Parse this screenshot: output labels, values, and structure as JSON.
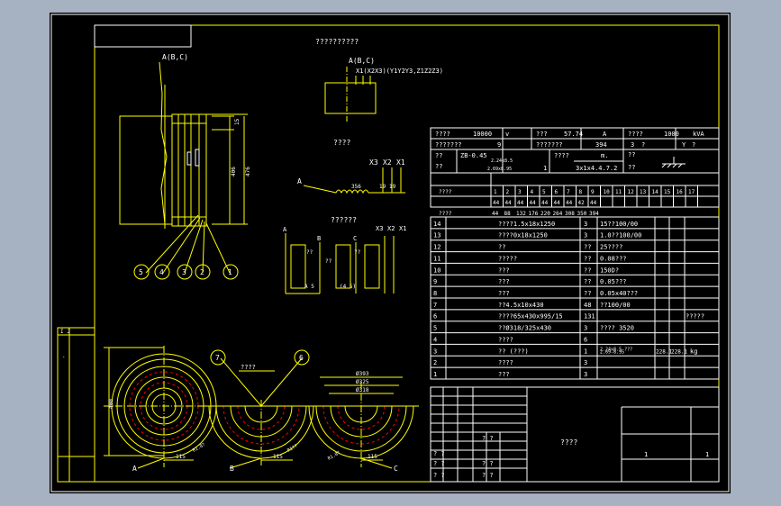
{
  "colors": {
    "background": "#a6b1c2",
    "sheet": "#000000",
    "frame": "#ffffff",
    "lines": "#ffff00",
    "text": "#ffffff",
    "red": "#ff0000"
  },
  "drawing": {
    "title_top": "??????????",
    "view_label_left": "A(B,C)",
    "view_label_right": "A(B,C)",
    "winding_terminals": "X1(X2X3)(Y1Y2Y3,Z1Z2Z3)",
    "tap_title": "????",
    "tap_terminals": [
      "X3",
      "X2",
      "X1"
    ],
    "tap_a": "A",
    "tap_numbers": [
      "356",
      "19",
      "19"
    ],
    "wiring_title": "??????",
    "wiring_terminals": [
      "X3",
      "X2",
      "X1"
    ],
    "wiring_phases": [
      "A",
      "B",
      "C"
    ],
    "wiring_marks": [
      "??",
      "??",
      "??"
    ],
    "wiring_bottom": [
      "A 5",
      "(4 5)"
    ],
    "dim_15": "15",
    "dim_406": "406",
    "dim_476": "476",
    "callouts": [
      "5",
      "4",
      "3",
      "2",
      "1",
      "7",
      "6"
    ],
    "plan_labels": [
      "A",
      "B",
      "C"
    ],
    "dim_400": "400",
    "dim_115": [
      "115",
      "115",
      "115"
    ],
    "plan_center_mark": "????",
    "dims_c": [
      "Ø393",
      "Ø325",
      "Ø318"
    ],
    "small_dims": [
      "R1.8?",
      "R1??",
      "R1.8?"
    ],
    "left_strip": [
      "I J",
      "."
    ]
  },
  "spec_table": {
    "rows": [
      [
        "????",
        "10000",
        "v",
        "???",
        "57.74",
        "A",
        "????",
        "1000",
        "kVA"
      ],
      [
        "???????",
        "9",
        "",
        "???????",
        "394",
        "",
        "3",
        "?",
        "Y",
        "?"
      ]
    ],
    "row3": {
      "label1": "??",
      "label2": "??",
      "code": "ZB-0.45",
      "wire1": "2.24x8.5",
      "wire2": "2.69x8.95",
      "mid_label": "????",
      "unit": "m.",
      "n1": "1",
      "n2": "3x1x4.4.7.2",
      "r_label": "??",
      "r2": "??"
    },
    "count_header": [
      "????",
      "1",
      "2",
      "3",
      "4",
      "5",
      "6",
      "7",
      "8",
      "9",
      "10",
      "11",
      "12",
      "13",
      "14",
      "15",
      "16",
      "17"
    ],
    "count_row1": [
      "44",
      "44",
      "44",
      "44",
      "44",
      "44",
      "44",
      "42",
      "44"
    ],
    "count_row2": [
      "????",
      "44",
      "88",
      "132",
      "176",
      "220",
      "264",
      "308",
      "350",
      "394"
    ]
  },
  "bom": [
    {
      "n": "14",
      "name": "????1.5x18x1250",
      "qty": "3",
      "spec": "15??100/00"
    },
    {
      "n": "13",
      "name": "????0x18x1250",
      "qty": "3",
      "spec": "1.0??100/00"
    },
    {
      "n": "12",
      "name": "??",
      "qty": "??",
      "spec": "25????"
    },
    {
      "n": "11",
      "name": "?????",
      "qty": "??",
      "spec": "0.08???"
    },
    {
      "n": "10",
      "name": "???",
      "qty": "??",
      "spec": "150D?"
    },
    {
      "n": "9",
      "name": "???",
      "qty": "??",
      "spec": "0.05???"
    },
    {
      "n": "8",
      "name": "???",
      "qty": "??",
      "spec": "0.05x40???"
    },
    {
      "n": "7",
      "name": "??4.5x10x430",
      "qty": "48",
      "spec": "??100/00"
    },
    {
      "n": "6",
      "name": "????65x430x995/15",
      "qty": "131",
      "spec": "",
      "extra": "?????"
    },
    {
      "n": "5",
      "name": "??Ø318/325x430",
      "qty": "3",
      "spec": "???? 3520"
    },
    {
      "n": "4",
      "name": "????",
      "qty": "6",
      "spec": ""
    },
    {
      "n": "3",
      "name": "?? (???)",
      "qty": "1",
      "spec": "2.24x8.5 ???",
      "spec2": "2.69-8.95",
      "w1": "228.1",
      "w2": "228.1",
      "u": "kg"
    },
    {
      "n": "2",
      "name": "????",
      "qty": "3",
      "spec": ""
    },
    {
      "n": "1",
      "name": "???",
      "qty": "3",
      "spec": ""
    }
  ],
  "title_block": {
    "name": "????",
    "small": [
      "? ?",
      "? ?",
      "? ?",
      "? ?",
      "? ?",
      "? ?"
    ],
    "right": [
      "1",
      "1"
    ]
  }
}
